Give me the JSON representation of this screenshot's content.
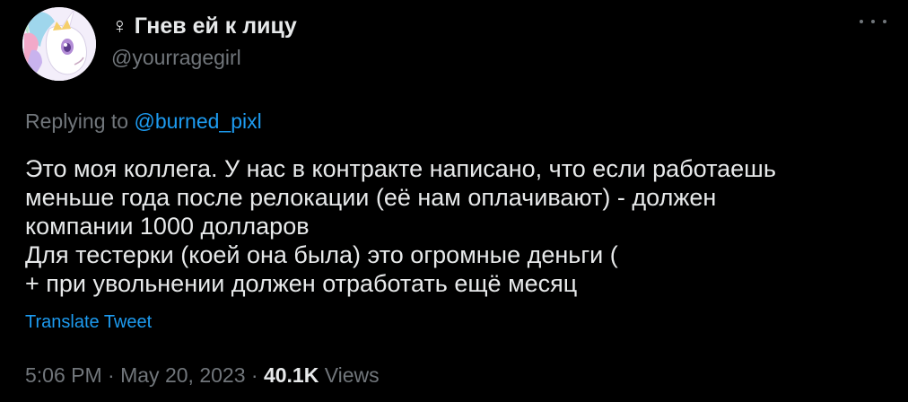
{
  "author": {
    "display_name_symbol": "♀",
    "display_name": "Гнев ей к лицу",
    "handle": "@yourragegirl",
    "avatar_icon": "celestia-pony-avatar-icon"
  },
  "reply": {
    "prefix": "Replying to",
    "mention": "@burned_pixl"
  },
  "tweet": {
    "lines": [
      "Это  моя коллега. У нас в контракте написано, что если работаешь",
      "меньше года после релокации (её нам оплачивают) - должен",
      "компании 1000 долларов",
      "Для тестерки (коей она была) это огромные деньги (",
      "+ при увольнении должен отработать ещё месяц"
    ],
    "translate_label": "Translate Tweet"
  },
  "meta": {
    "time": "5:06 PM",
    "date": "May 20, 2023",
    "views_count": "40.1K",
    "views_label": "Views",
    "separator": "·"
  },
  "colors": {
    "background": "#000000",
    "text_primary": "#e7e9ea",
    "text_secondary": "#71767b",
    "link": "#1d9bf0"
  }
}
